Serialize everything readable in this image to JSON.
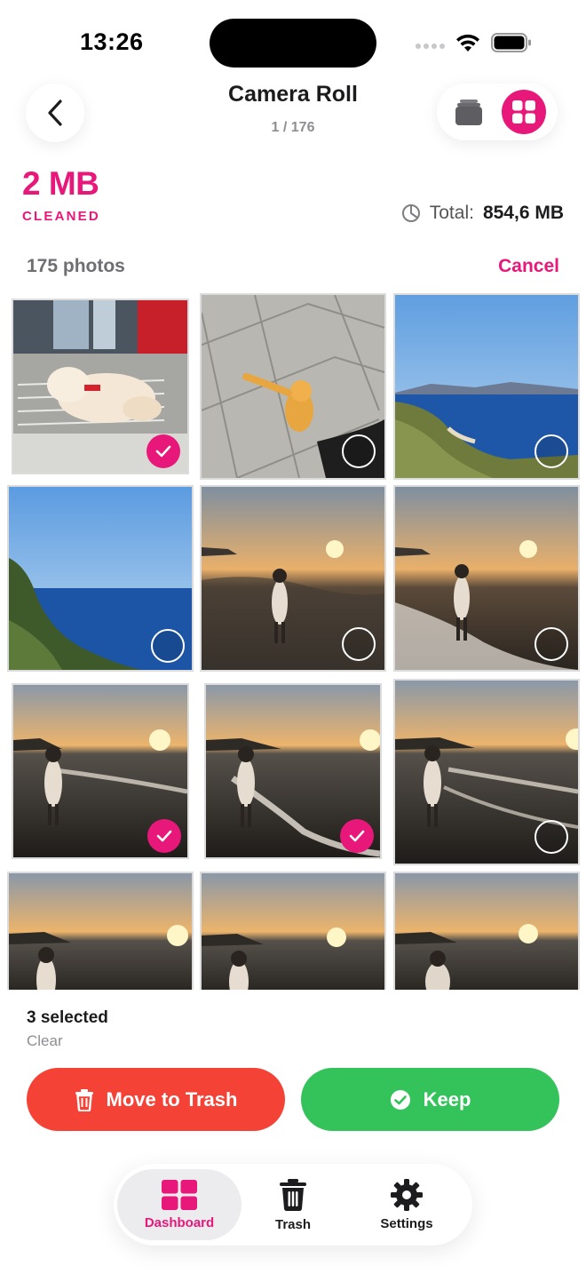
{
  "status_bar": {
    "time": "13:26"
  },
  "header": {
    "title": "Camera Roll",
    "subtitle": "1 / 176"
  },
  "stats": {
    "cleaned_value": "2 MB",
    "cleaned_label": "CLEANED",
    "total_label": "Total:",
    "total_value": "854,6 MB"
  },
  "list": {
    "count_label": "175 photos",
    "cancel_label": "Cancel"
  },
  "photos": [
    {
      "subject": "cat sleeping on freezer",
      "selected": true
    },
    {
      "subject": "orange kitten on tiles",
      "selected": false
    },
    {
      "subject": "coastal bay",
      "selected": false
    },
    {
      "subject": "sea and shrubs",
      "selected": false
    },
    {
      "subject": "sunset beach person",
      "selected": false
    },
    {
      "subject": "sunset beach person",
      "selected": false
    },
    {
      "subject": "sunset beach person",
      "selected": true
    },
    {
      "subject": "sunset beach person",
      "selected": true
    },
    {
      "subject": "sunset beach person",
      "selected": false
    },
    {
      "subject": "sunset beach person",
      "selected": false
    },
    {
      "subject": "sunset beach person",
      "selected": false
    },
    {
      "subject": "sunset beach person",
      "selected": false
    }
  ],
  "selection": {
    "count_label": "3 selected",
    "clear_label": "Clear"
  },
  "actions": {
    "trash_label": "Move to Trash",
    "keep_label": "Keep"
  },
  "tabbar": {
    "items": [
      {
        "label": "Dashboard",
        "icon": "grid-icon",
        "active": true
      },
      {
        "label": "Trash",
        "icon": "trash-icon",
        "active": false
      },
      {
        "label": "Settings",
        "icon": "gear-icon",
        "active": false
      }
    ]
  },
  "colors": {
    "accent": "#e8177a",
    "trash": "#f44336",
    "keep": "#33c35a"
  }
}
